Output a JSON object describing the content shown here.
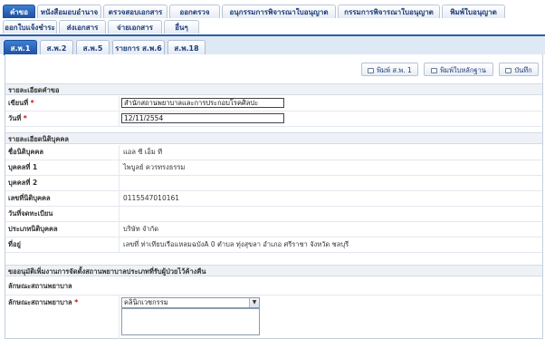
{
  "top_tabs": [
    "คำขอ",
    "หนังสือมอบอำนาจ",
    "ตรวจสอบเอกสาร",
    "ออกตรวจ",
    "อนุกรรมการพิจารณาใบอนุญาต",
    "กรรมการพิจารณาใบอนุญาต",
    "พิมพ์ใบอนุญาต",
    "ออกใบแจ้งชำระ",
    "ส่งเอกสาร",
    "จ่ายเอกสาร",
    "อื่นๆ"
  ],
  "sub_tabs": [
    "ส.พ.1",
    "ส.พ.2",
    "ส.พ.5",
    "รายการ ส.พ.6",
    "ส.พ.18"
  ],
  "toolbar": {
    "print_sp1": "พิมพ์ ส.พ. 1",
    "print_evidence": "พิมพ์ใบหลักฐาน",
    "save": "บันทึก"
  },
  "request": {
    "section_title": "รายละเอียดคำขอ",
    "written_at_label": "เขียนที่",
    "written_at_value": "สำนักสถานพยาบาลและการประกอบโรคศิลปะ",
    "date_label": "วันที่",
    "date_value": "12/11/2554"
  },
  "juristic": {
    "section_title": "รายละเอียดนิติบุคคล",
    "rows": [
      {
        "label": "ชื่อนิติบุคคล",
        "value": "แอล ซี เอ็ม ที"
      },
      {
        "label": "บุคคลที่ 1",
        "value": "ไพบูลย์ ควรทรงธรรม"
      },
      {
        "label": "บุคคลที่ 2",
        "value": ""
      },
      {
        "label": "เลขที่นิติบุคคล",
        "value": "0115547010161"
      },
      {
        "label": "วันที่จดทะเบียน",
        "value": ""
      },
      {
        "label": "ประเภทนิติบุคคล",
        "value": "บริษัท จำกัด"
      },
      {
        "label": "ที่อยู่",
        "value": "เลขที่ ท่าเทียบเรือแหลมฉบังA 0 ตำบล ทุ่งสุขลา อำเภอ ศรีราชา จังหวัด ชลบุรี"
      }
    ]
  },
  "permit": {
    "section_title": "ขออนุมัติเพิ่มงานการจัดตั้งสถานพยาบาลประเภทที่รับผู้ป่วยไว้ค้างคืน",
    "subsection_title": "ลักษณะสถานพยาบาล",
    "type_label": "ลักษณะสถานพยาบาล",
    "type_value": "คลินิกเวชกรรม"
  }
}
